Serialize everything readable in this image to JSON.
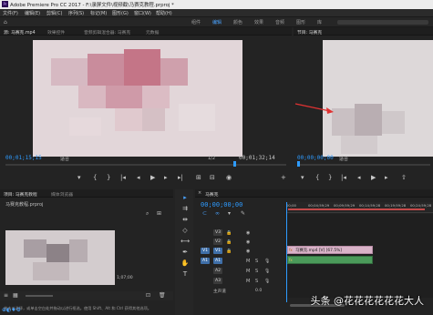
{
  "window": {
    "title": "Adobe Premiere Pro CC 2017 - F:\\录屏文件\\视频截\\马赛克教程.prproj *"
  },
  "menu": [
    "文件(F)",
    "编辑(E)",
    "剪辑(C)",
    "序列(S)",
    "标记(M)",
    "图形(G)",
    "窗口(W)",
    "帮助(H)"
  ],
  "workspaces": [
    "组件",
    "编辑",
    "颜色",
    "效果",
    "音频",
    "图形",
    "库"
  ],
  "workspaces_active": 1,
  "source_panel": {
    "tabs": [
      "源: 马赛克.mp4",
      "效果控件",
      "音频剪辑混合器: 马赛克",
      "元数据"
    ],
    "timecode_in": "00;01;15;15",
    "fit": "适合",
    "page": "1/2",
    "timecode_out": "00;01;32;14"
  },
  "program_panel": {
    "tabs": [
      "节目: 马赛克"
    ],
    "timecode": "00;00;00;00",
    "fit": "适合"
  },
  "project_panel": {
    "tabs": [
      "项目: 马赛克教程",
      "媒体浏览器"
    ],
    "item_name": "马赛克教程.prproj",
    "clip_duration": "1;07;00",
    "info_line": "单击以选择，或单击空白处并拖动以进行框选。使用 Shift、Alt 和 Ctrl 获得其他选项。"
  },
  "timeline": {
    "tab": "马赛克",
    "timecode": "00;00;00;00",
    "ruler": [
      "00;00",
      "00;04;59;29",
      "00;09;59;29",
      "00;14;59;28",
      "00;19;59;28",
      "00;24;59;28"
    ],
    "tracks": [
      "V3",
      "V2",
      "V1",
      "A1",
      "A2",
      "A3"
    ],
    "master_label": "主声道",
    "master_value": "0.0",
    "clip_label": "马赛克.mp4 [V] [67.5%]",
    "audio_clip_label": "fx"
  },
  "overlay": {
    "watermark": "头条 @花花花花花花大人"
  },
  "colors": {
    "accent": "#2e9bff",
    "clip_video": "#d9b3c8",
    "clip_audio": "#4b9a5a",
    "playhead": "#2e9bff",
    "arrow": "#e03232"
  }
}
